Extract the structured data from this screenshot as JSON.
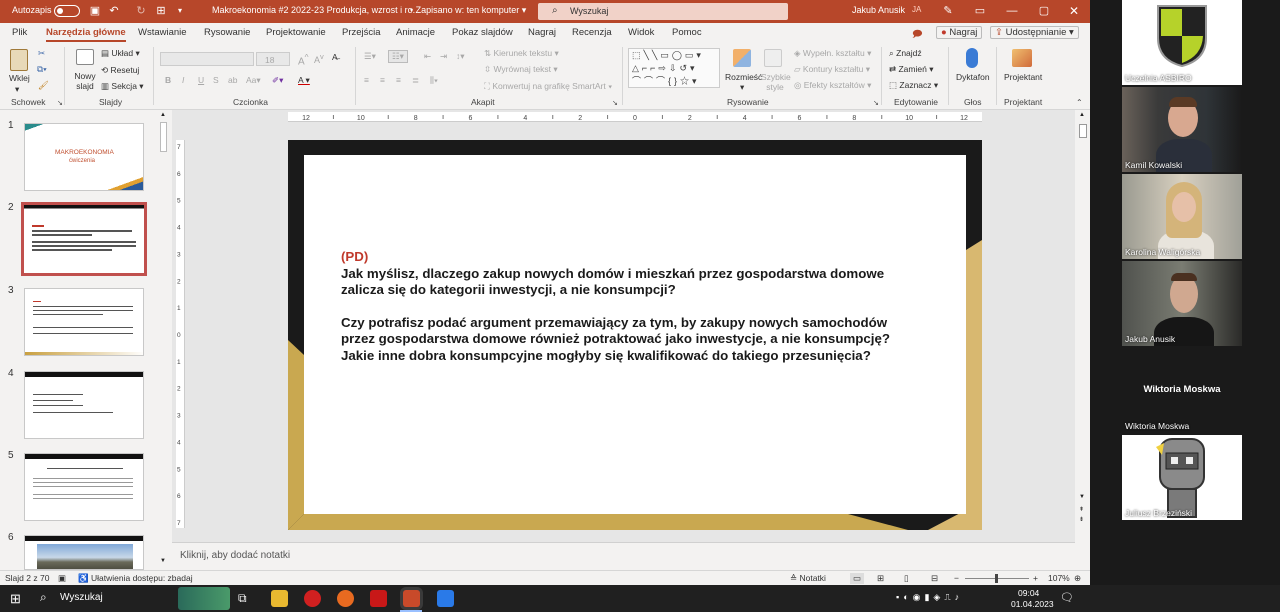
{
  "window": {
    "autosave_label": "Autozapis",
    "title": "Makroekonomia #2 2022-23 Produkcja, wzrost i ro...",
    "save_status": "Zapisano w: ten komputer",
    "search_placeholder": "Wyszukaj",
    "user_name": "Jakub Anusik",
    "user_initials": "JA",
    "accent_color": "#b7472a"
  },
  "tabs": [
    "Plik",
    "Narzędzia główne",
    "Wstawianie",
    "Rysowanie",
    "Projektowanie",
    "Przejścia",
    "Animacje",
    "Pokaz slajdów",
    "Nagraj",
    "Recenzja",
    "Widok",
    "Pomoc"
  ],
  "tabs_active_index": 1,
  "tabs_right": {
    "record": "Nagraj",
    "share": "Udostępnianie"
  },
  "ribbon": {
    "schowek": {
      "paste": "Wklej",
      "group": "Schowek"
    },
    "slajdy": {
      "new_slide": "Nowy slajd",
      "layout": "Układ",
      "reset": "Resetuj",
      "section": "Sekcja",
      "group": "Slajdy"
    },
    "czcionka": {
      "font_size": "18",
      "bold": "B",
      "italic": "I",
      "underline": "U",
      "strike": "S",
      "group": "Czcionka"
    },
    "akapit": {
      "text_direction": "Kierunek tekstu",
      "align_text": "Wyrównaj tekst",
      "smartart": "Konwertuj na grafikę SmartArt",
      "group": "Akapit"
    },
    "rysowanie": {
      "arrange": "Rozmieść",
      "quick_styles": "Szybkie style",
      "fill": "Wypełn. kształtu",
      "outline": "Kontury kształtu",
      "effects": "Efekty kształtów",
      "group": "Rysowanie"
    },
    "edytowanie": {
      "find": "Znajdź",
      "replace": "Zamień",
      "select": "Zaznacz",
      "group": "Edytowanie"
    },
    "glos": {
      "dictate": "Dyktafon",
      "group": "Głos"
    },
    "projektant": {
      "designer": "Projektant",
      "group": "Projektant"
    }
  },
  "slides": [
    "1",
    "2",
    "3",
    "4",
    "5",
    "6"
  ],
  "slides_selected": 2,
  "thumb1": {
    "title": "MAKROEKONOMIA",
    "subtitle": "ćwiczenia"
  },
  "ruler_h": [
    "12",
    "10",
    "8",
    "6",
    "4",
    "2",
    "0",
    "2",
    "4",
    "6",
    "8",
    "10",
    "12"
  ],
  "ruler_v": [
    "7",
    "6",
    "5",
    "4",
    "3",
    "2",
    "1",
    "0",
    "1",
    "2",
    "3",
    "4",
    "5",
    "6",
    "7"
  ],
  "slide": {
    "tag": "(PD)",
    "paragraph1": "Jak myślisz, dlaczego zakup nowych domów i mieszkań przez gospodarstwa domowe zalicza się do kategorii inwestycji, a nie konsumpcji?",
    "paragraph2": "Czy potrafisz podać argument przemawiający za tym, by zakupy nowych samochodów przez gospodarstwa domowe również potraktować jako inwestycje, a nie konsumpcję? Jakie inne dobra konsumpcyjne mogłyby się kwalifikować do takiego przesunięcia?"
  },
  "notes_placeholder": "Kliknij, aby dodać notatki",
  "status": {
    "slide_counter": "Slajd 2 z 70",
    "accessibility": "Ułatwienia dostępu: zbadaj",
    "notes": "Notatki",
    "zoom": "107%"
  },
  "participants": [
    {
      "name": "Uczelnia ASBIRO",
      "kind": "logo"
    },
    {
      "name": "Kamil Kowalski",
      "kind": "video"
    },
    {
      "name": "Karolina Waligórska",
      "kind": "video"
    },
    {
      "name": "Jakub Anusik",
      "kind": "video"
    },
    {
      "name": "Wiktoria Moskwa",
      "kind": "no-video",
      "center_label": "Wiktoria Moskwa"
    },
    {
      "name": "Juliusz Brzeziński",
      "kind": "avatar"
    }
  ],
  "taskbar": {
    "search": "Wyszukaj",
    "time": "09:04",
    "date": "01.04.2023"
  }
}
